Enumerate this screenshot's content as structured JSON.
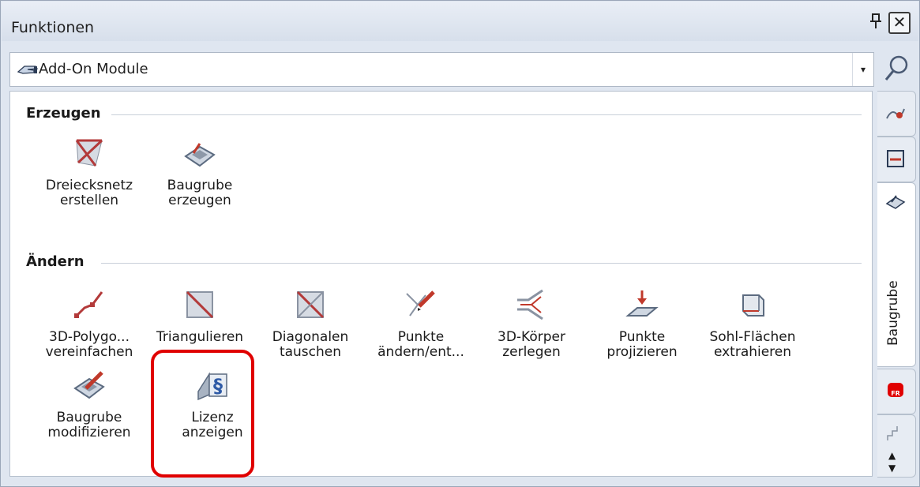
{
  "window": {
    "title": "Funktionen",
    "pin_glyph": "p",
    "close_glyph": "✕"
  },
  "combo": {
    "icon": "addon-hand-icon",
    "value": "Add-On Module",
    "arrow": "▾"
  },
  "sections": [
    {
      "label": "Erzeugen"
    },
    {
      "label": "Ändern"
    }
  ],
  "tools_create": [
    {
      "icon": "triangle-mesh-icon",
      "label": "Dreiecksnetz\nerstellen"
    },
    {
      "icon": "excavation-create-icon",
      "label": "Baugrube\nerzeugen"
    }
  ],
  "tools_modify": [
    {
      "icon": "polygon-simplify-icon",
      "label": "3D-Polygo...\nvereinfachen"
    },
    {
      "icon": "triangulate-icon",
      "label": "Triangulieren"
    },
    {
      "icon": "swap-diagonals-icon",
      "label": "Diagonalen\ntauschen"
    },
    {
      "icon": "edit-points-icon",
      "label": "Punkte\nändern/ent..."
    },
    {
      "icon": "split-solid-icon",
      "label": "3D-Körper\nzerlegen"
    },
    {
      "icon": "project-points-icon",
      "label": "Punkte\nprojizieren"
    },
    {
      "icon": "extract-base-faces-icon",
      "label": "Sohl-Flächen\nextrahieren"
    },
    {
      "icon": "excavation-modify-icon",
      "label": "Baugrube\nmodifizieren"
    },
    {
      "icon": "license-icon",
      "label": "Lizenz\nanzeigen"
    }
  ],
  "vtabs": {
    "active_label": "Baugrube"
  },
  "colors": {
    "accent_red": "#c0392b",
    "highlight": "#e00000"
  }
}
